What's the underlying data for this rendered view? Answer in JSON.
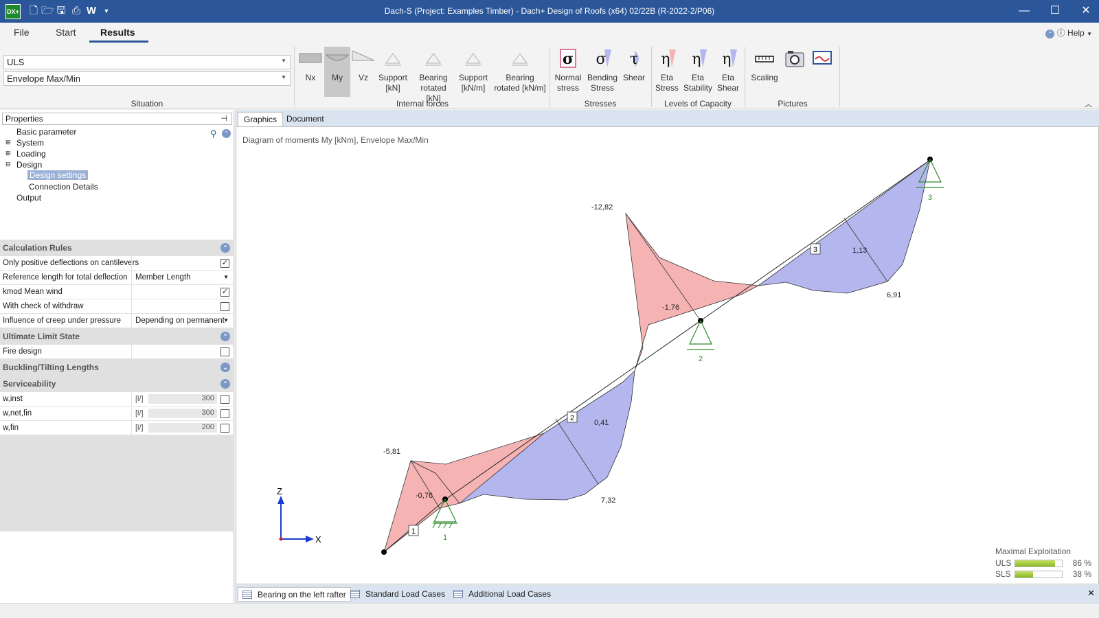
{
  "window": {
    "title": "Dach-S (Project: Examples Timber) - Dach+ Design of Roofs (x64) 02/22B (R-2022-2/P06)",
    "app_icon_text": "DX+",
    "quick_access_w": "W"
  },
  "menu": {
    "items": [
      "File",
      "Start",
      "Results"
    ],
    "active": "Results",
    "help": "Help"
  },
  "ribbon": {
    "situation": {
      "combo1": "ULS",
      "combo2": "Envelope Max/Min",
      "label": "Situation"
    },
    "internal_forces": {
      "label": "Internal forces",
      "buttons": [
        "Nx",
        "My",
        "Vz",
        "Support [kN]",
        "Bearing rotated [kN]",
        "Support [kN/m]",
        "Bearing rotated [kN/m]"
      ],
      "selected": "My"
    },
    "stresses": {
      "label": "Stresses",
      "buttons": [
        "Normal stress",
        "Bending Stress",
        "Shear"
      ]
    },
    "capacity": {
      "label": "Levels of Capacity",
      "buttons": [
        "Eta Stress",
        "Eta Stability",
        "Eta Shear"
      ]
    },
    "pictures": {
      "label": "Pictures",
      "buttons": [
        "Scaling"
      ]
    }
  },
  "properties": {
    "header": "Properties",
    "tree": [
      "Basic parameter",
      "System",
      "Loading",
      "Design",
      "Design settings",
      "Connection Details",
      "Output"
    ],
    "sections": {
      "calc_rules": "Calculation Rules",
      "uls": "Ultimate Limit State",
      "buckling": "Buckling/Tilting Lengths",
      "sls": "Serviceability"
    },
    "calc_rows": [
      {
        "label": "Only positive deflections on cantilevers",
        "value": "",
        "checked": true
      },
      {
        "label": "Reference length for total deflection",
        "value": "Member Length"
      },
      {
        "label": "kmod Mean wind",
        "value": "",
        "checked": true
      },
      {
        "label": "With  check of withdraw",
        "value": "",
        "checked": false
      },
      {
        "label": "Influence of creep under pressure",
        "value": "Depending on permanent"
      }
    ],
    "uls_rows": [
      {
        "label": "Fire design",
        "checked": false
      }
    ],
    "sls_rows": [
      {
        "label": "w,inst",
        "unit": "[l/]",
        "value": "300"
      },
      {
        "label": "w,net,fin",
        "unit": "[l/]",
        "value": "300"
      },
      {
        "label": "w,fin",
        "unit": "[l/]",
        "value": "200"
      }
    ]
  },
  "view_tabs": [
    "Graphics",
    "Document"
  ],
  "graphics": {
    "caption": "Diagram of moments My [kNm], Envelope Max/Min",
    "values": [
      "-12,82",
      "-1,76",
      "1,13",
      "6,91",
      "-5,81",
      "-0,76",
      "0,41",
      "7,32"
    ],
    "members": [
      "1",
      "2",
      "3"
    ],
    "supports": [
      "1",
      "2",
      "3"
    ],
    "axes": {
      "z": "Z",
      "x": "X"
    },
    "colors": {
      "positive": "#b4b6ee",
      "negative": "#f6b3b3",
      "support": "#2b8a2b"
    }
  },
  "exploitation": {
    "title": "Maximal Exploitation",
    "items": [
      {
        "name": "ULS",
        "value": 86,
        "label": "86 %"
      },
      {
        "name": "SLS",
        "value": 38,
        "label": "38 %"
      }
    ]
  },
  "bottom_tabs": [
    "Bearing on the left rafter",
    "Standard Load Cases",
    "Additional Load Cases"
  ]
}
